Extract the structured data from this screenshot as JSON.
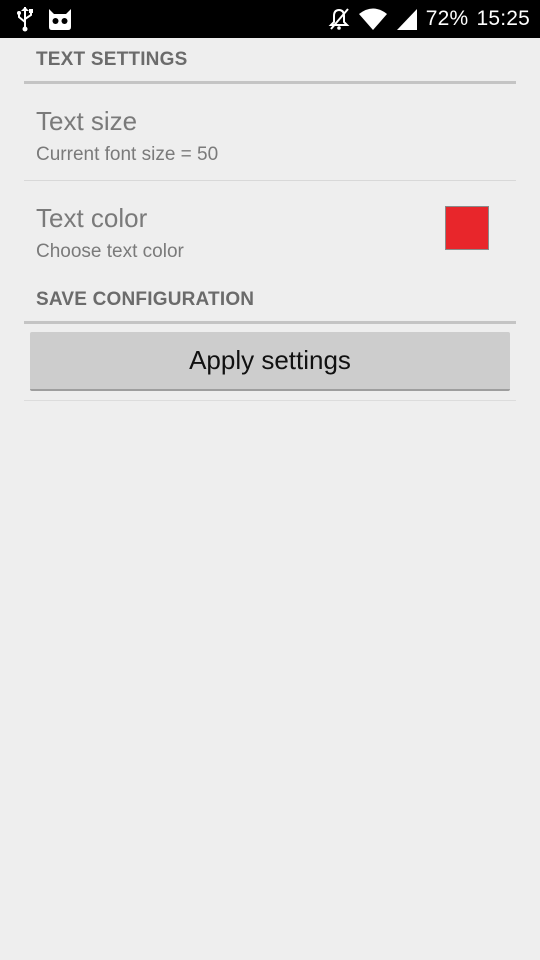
{
  "status_bar": {
    "left_icons": [
      "usb-icon",
      "cyanogenmod-icon"
    ],
    "right_icons": [
      "muted-icon",
      "wifi-icon",
      "signal-icon"
    ],
    "battery": "72%",
    "time": "15:25"
  },
  "sections": [
    {
      "header": "TEXT SETTINGS",
      "items": [
        {
          "title": "Text size",
          "summary": "Current font size = 50"
        },
        {
          "title": "Text color",
          "summary": "Choose text color",
          "swatch_color": "#e8262b"
        }
      ]
    },
    {
      "header": "SAVE CONFIGURATION",
      "button_label": "Apply settings"
    }
  ],
  "colors": {
    "background": "#eeeeee",
    "status_bar": "#000000",
    "header_text": "#6b6b6b",
    "pref_text": "#7a7a7a",
    "button_bg": "#cdcdcd"
  }
}
